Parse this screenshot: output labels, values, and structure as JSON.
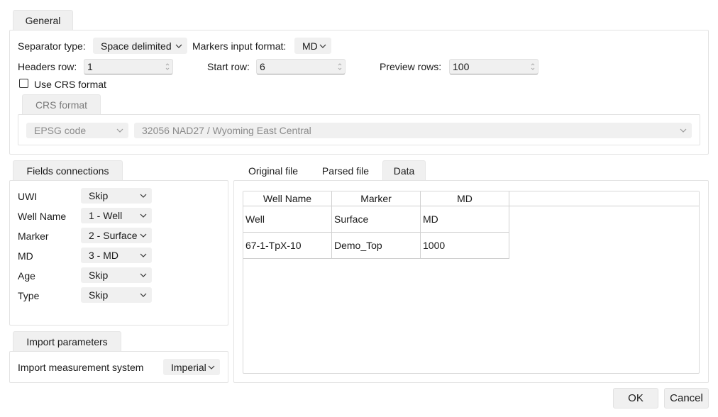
{
  "general": {
    "tab_label": "General",
    "separator_label": "Separator type:",
    "separator_value": "Space delimited",
    "markers_format_label": "Markers input format:",
    "markers_format_value": "MD",
    "headers_row_label": "Headers row:",
    "headers_row_value": "1",
    "start_row_label": "Start row:",
    "start_row_value": "6",
    "preview_rows_label": "Preview rows:",
    "preview_rows_value": "100",
    "use_crs_label": "Use CRS format",
    "use_crs_checked": false,
    "crs": {
      "tab_label": "CRS format",
      "code_type": "EPSG code",
      "crs_value": "32056 NAD27 / Wyoming East Central"
    }
  },
  "fields": {
    "tab_label": "Fields connections",
    "rows": [
      {
        "label": "UWI",
        "value": "Skip"
      },
      {
        "label": "Well Name",
        "value": "1 - Well"
      },
      {
        "label": "Marker",
        "value": "2 - Surface"
      },
      {
        "label": "MD",
        "value": "3 - MD"
      },
      {
        "label": "Age",
        "value": "Skip"
      },
      {
        "label": "Type",
        "value": "Skip"
      }
    ]
  },
  "import": {
    "tab_label": "Import parameters",
    "measurement_label": "Import measurement system",
    "measurement_value": "Imperial"
  },
  "preview": {
    "tabs": [
      "Original file",
      "Parsed file",
      "Data"
    ],
    "active_tab": "Data",
    "columns": [
      "Well Name",
      "Marker",
      "MD"
    ],
    "rows": [
      [
        "Well",
        "Surface",
        "MD"
      ],
      [
        "67-1-TpX-10",
        "Demo_Top",
        "1000"
      ]
    ]
  },
  "buttons": {
    "ok": "OK",
    "cancel": "Cancel"
  },
  "colors": {
    "control_bg": "#f0f0f0",
    "border": "#e3e3e3",
    "disabled_text": "#8a8a8a"
  }
}
